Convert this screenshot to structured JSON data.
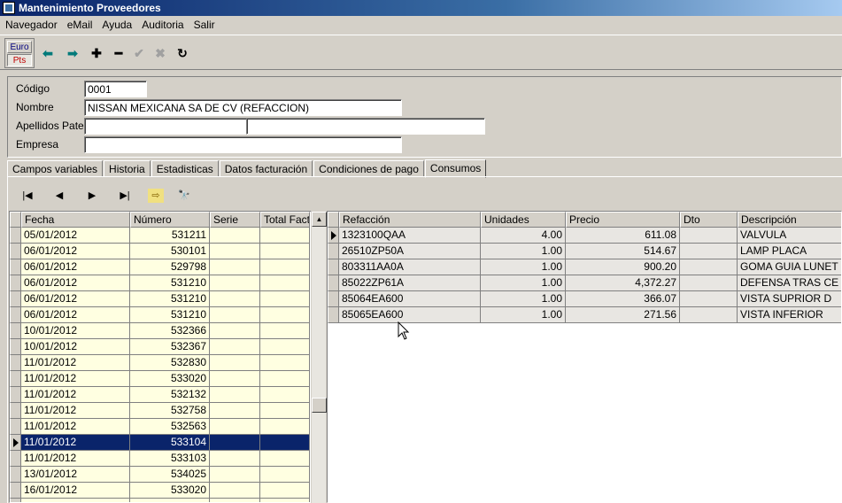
{
  "window": {
    "title": "Mantenimiento Proveedores"
  },
  "menu": [
    "Navegador",
    "eMail",
    "Ayuda",
    "Auditoria",
    "Salir"
  ],
  "toolbar": {
    "euro_label": "Euro",
    "pts_label": "Pts",
    "prev_icon": "arrow-left-icon",
    "next_icon": "arrow-right-icon",
    "add_icon": "plus-icon",
    "delete_icon": "minus-icon",
    "post_icon": "check-icon",
    "cancel_icon": "x-icon",
    "refresh_icon": "refresh-icon",
    "glyphs": {
      "prev": "⬅",
      "next": "➡",
      "add": "✚",
      "delete": "━",
      "post": "✔",
      "cancel": "✖",
      "refresh": "↻"
    }
  },
  "form": {
    "codigo_label": "Código",
    "codigo_value": "0001",
    "nombre_label": "Nombre",
    "nombre_value": "NISSAN MEXICANA SA DE CV (REFACCION)",
    "apellidos_label": "Apellidos Paterno",
    "apellido1_value": "",
    "apellido2_value": "",
    "empresa_label": "Empresa",
    "empresa_value": ""
  },
  "tabs": [
    "Campos variables",
    "Historia",
    "Estadisticas",
    "Datos facturación",
    "Condiciones de pago",
    "Consumos"
  ],
  "active_tab": "Consumos",
  "navigator": {
    "first": "|◀",
    "prior": "◀",
    "next": "▶",
    "last": "▶|",
    "filter": "⇨",
    "search": "🔭"
  },
  "left_grid": {
    "columns": [
      "Fecha",
      "Número",
      "Serie",
      "Total Factu"
    ],
    "rows": [
      [
        "05/01/2012",
        "531211",
        "",
        ""
      ],
      [
        "06/01/2012",
        "530101",
        "",
        ""
      ],
      [
        "06/01/2012",
        "529798",
        "",
        ""
      ],
      [
        "06/01/2012",
        "531210",
        "",
        ""
      ],
      [
        "06/01/2012",
        "531210",
        "",
        ""
      ],
      [
        "06/01/2012",
        "531210",
        "",
        ""
      ],
      [
        "10/01/2012",
        "532366",
        "",
        ""
      ],
      [
        "10/01/2012",
        "532367",
        "",
        ""
      ],
      [
        "11/01/2012",
        "532830",
        "",
        ""
      ],
      [
        "11/01/2012",
        "533020",
        "",
        ""
      ],
      [
        "11/01/2012",
        "532132",
        "",
        ""
      ],
      [
        "11/01/2012",
        "532758",
        "",
        ""
      ],
      [
        "11/01/2012",
        "532563",
        "",
        ""
      ],
      [
        "11/01/2012",
        "533104",
        "",
        ""
      ],
      [
        "11/01/2012",
        "533103",
        "",
        ""
      ],
      [
        "13/01/2012",
        "534025",
        "",
        ""
      ],
      [
        "16/01/2012",
        "533020",
        "",
        ""
      ],
      [
        "",
        "",
        "",
        ""
      ]
    ],
    "selected_index": 13
  },
  "right_grid": {
    "columns": [
      "Refacción",
      "Unidades",
      "Precio",
      "Dto",
      "Descripción"
    ],
    "rows": [
      [
        "1323100QAA",
        "4.00",
        "611.08",
        "",
        "VALVULA"
      ],
      [
        "26510ZP50A",
        "1.00",
        "514.67",
        "",
        "LAMP PLACA"
      ],
      [
        "803311AA0A",
        "1.00",
        "900.20",
        "",
        "GOMA GUIA LUNET"
      ],
      [
        "85022ZP61A",
        "1.00",
        "4,372.27",
        "",
        "DEFENSA TRAS CE"
      ],
      [
        "85064EA600",
        "1.00",
        "366.07",
        "",
        "VISTA SUPRIOR D"
      ],
      [
        "85065EA600",
        "1.00",
        "271.56",
        "",
        "VISTA INFERIOR"
      ]
    ],
    "current_index": 0
  }
}
